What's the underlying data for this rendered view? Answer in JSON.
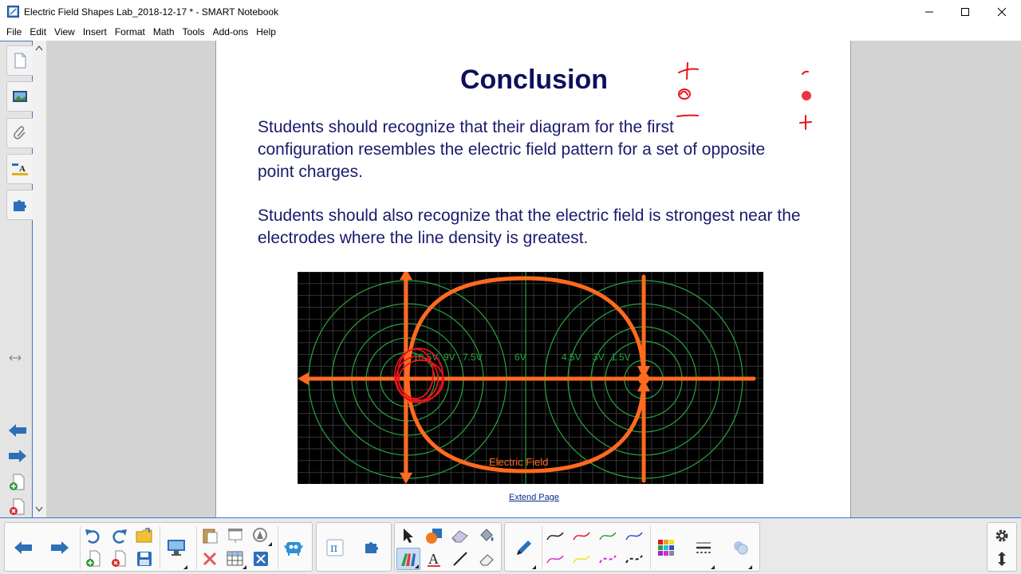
{
  "window": {
    "title": "Electric Field Shapes Lab_2018-12-17 * - SMART Notebook",
    "controls": [
      "minimize",
      "maximize",
      "close"
    ]
  },
  "menu": {
    "items": [
      "File",
      "Edit",
      "View",
      "Insert",
      "Format",
      "Math",
      "Tools",
      "Add-ons",
      "Help"
    ]
  },
  "side_tabs": [
    "page-sorter",
    "gallery",
    "attachments",
    "properties",
    "add-ons"
  ],
  "page": {
    "title": "Conclusion",
    "paragraph1": "Students should recognize that their diagram for the first configuration resembles the electric field pattern for a set of opposite point charges.",
    "paragraph2": "Students should also recognize that the electric field is strongest near the electrodes where the line density is greatest.",
    "extend_link": "Extend Page",
    "figure": {
      "voltage_labels": [
        "10.5V",
        "9V",
        "7.5V",
        "6V",
        "4.5V",
        "3V",
        "1.5V"
      ],
      "caption": "Electric Field",
      "colors": {
        "field_lines": "#ff6a1f",
        "equipotentials": "#2db34a",
        "grid": "#3a3a3a",
        "ink": "#e8141b"
      }
    }
  },
  "colors": {
    "accent": "#3a78c9",
    "title_text": "#0f0f5e",
    "body_text": "#1a1a6e"
  }
}
